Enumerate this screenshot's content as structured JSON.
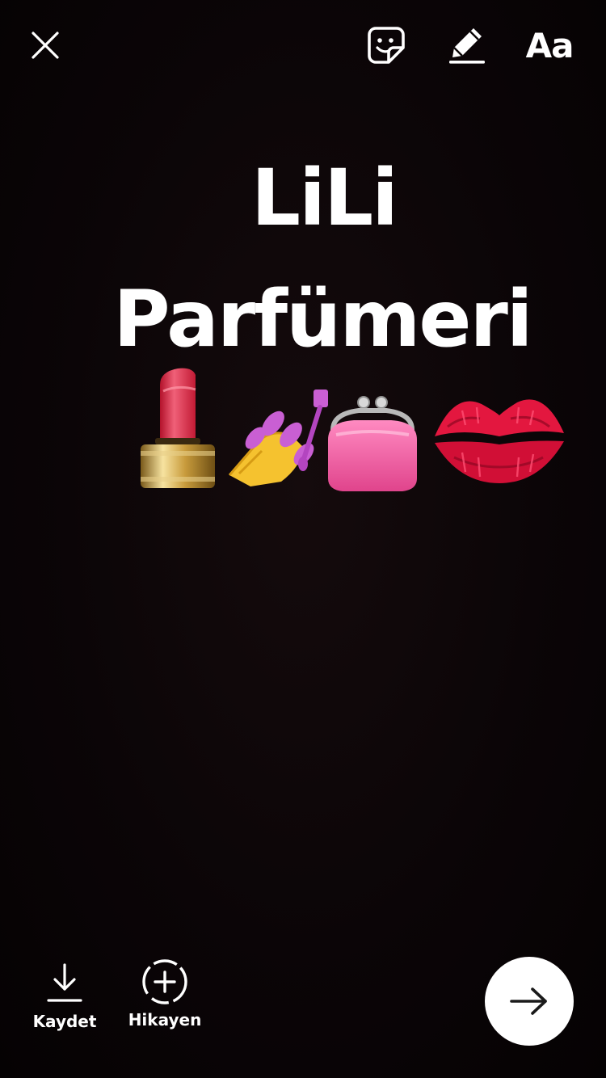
{
  "toolbar": {
    "close_icon": "close-icon",
    "sticker_icon": "sticker-icon",
    "draw_icon": "marker-icon",
    "text_tool_label": "Aa"
  },
  "story": {
    "line1": "LiLi",
    "line2": "Parfümeri",
    "emojis": [
      "lipstick",
      "nail-polish",
      "purse",
      "kiss-mark"
    ]
  },
  "bottom_bar": {
    "save_label": "Kaydet",
    "story_label": "Hikayen",
    "send_icon": "arrow-right-icon"
  },
  "colors": {
    "background": "#0b0607",
    "foreground": "#ffffff",
    "send_button": "#ffffff",
    "send_arrow": "#1a1a1a"
  }
}
